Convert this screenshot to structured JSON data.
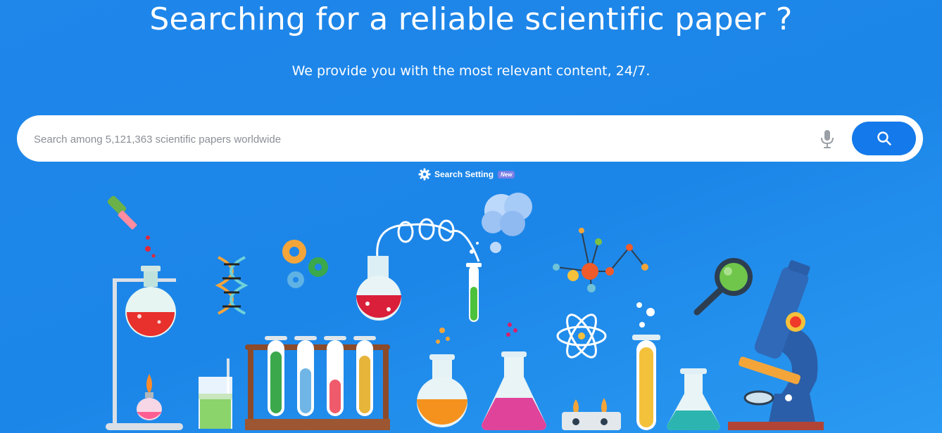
{
  "hero": {
    "title": "Searching for a reliable scientific paper ?",
    "subtitle": "We provide you with the most relevant content, 24/7."
  },
  "search": {
    "placeholder": "Search among 5,121,363 scientific papers worldwide",
    "value": "",
    "mic_icon": "microphone-icon",
    "button_icon": "search-icon"
  },
  "settings": {
    "label": "Search Setting",
    "badge": "New",
    "icon": "gear-icon"
  },
  "colors": {
    "background": "#1f86ea",
    "search_button": "#1479ea",
    "badge": "#7b7fe6"
  }
}
